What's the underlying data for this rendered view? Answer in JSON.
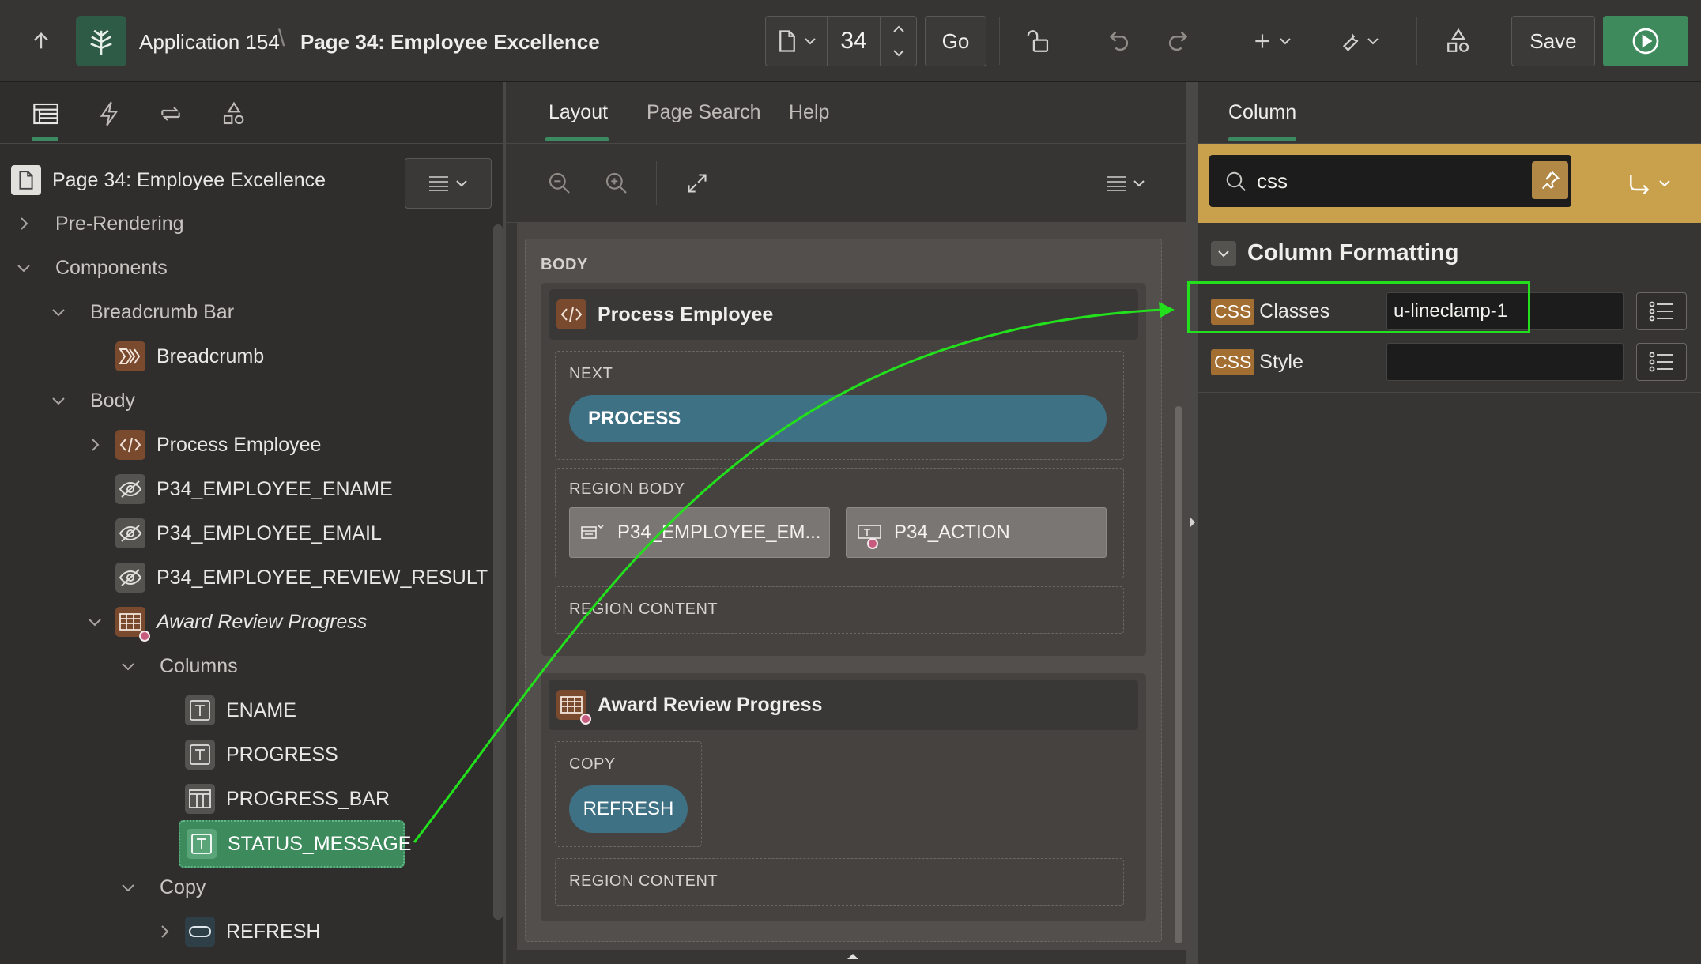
{
  "header": {
    "app_name": "Application 154",
    "page_title": "Page 34: Employee Excellence",
    "page_number": "34",
    "go_label": "Go",
    "save_label": "Save"
  },
  "left": {
    "page_node": "Page 34: Employee Excellence",
    "tree": {
      "pre_rendering": "Pre-Rendering",
      "components": "Components",
      "breadcrumb_bar": "Breadcrumb Bar",
      "breadcrumb": "Breadcrumb",
      "body": "Body",
      "process_employee": "Process Employee",
      "ename_item": "P34_EMPLOYEE_ENAME",
      "email_item": "P34_EMPLOYEE_EMAIL",
      "review_item": "P34_EMPLOYEE_REVIEW_RESULT",
      "award_review": "Award Review Progress",
      "columns": "Columns",
      "col_ename": "ENAME",
      "col_progress": "PROGRESS",
      "col_progress_bar": "PROGRESS_BAR",
      "col_status": "STATUS_MESSAGE",
      "copy": "Copy",
      "refresh": "REFRESH"
    }
  },
  "middle": {
    "tabs": [
      "Layout",
      "Page Search",
      "Help"
    ],
    "body_label": "BODY",
    "process_employee": {
      "title": "Process Employee",
      "next_label": "NEXT",
      "process_button": "PROCESS",
      "region_body_label": "REGION BODY",
      "item1": "P34_EMPLOYEE_EM...",
      "item2": "P34_ACTION",
      "region_content_label": "REGION CONTENT"
    },
    "award_review": {
      "title": "Award Review Progress",
      "copy_label": "COPY",
      "refresh_button": "REFRESH",
      "region_content_label": "REGION CONTENT"
    }
  },
  "right": {
    "tab": "Column",
    "search_value": "css",
    "group_title": "Column Formatting",
    "css_badge": "CSS",
    "classes_label": "Classes",
    "classes_value": "u-lineclamp-1",
    "style_label": "Style",
    "style_value": ""
  },
  "colors": {
    "accent_green": "#3b8a62",
    "search_bar": "#c9a04b",
    "highlight": "#22e01c",
    "pill_blue": "#3f7185"
  }
}
